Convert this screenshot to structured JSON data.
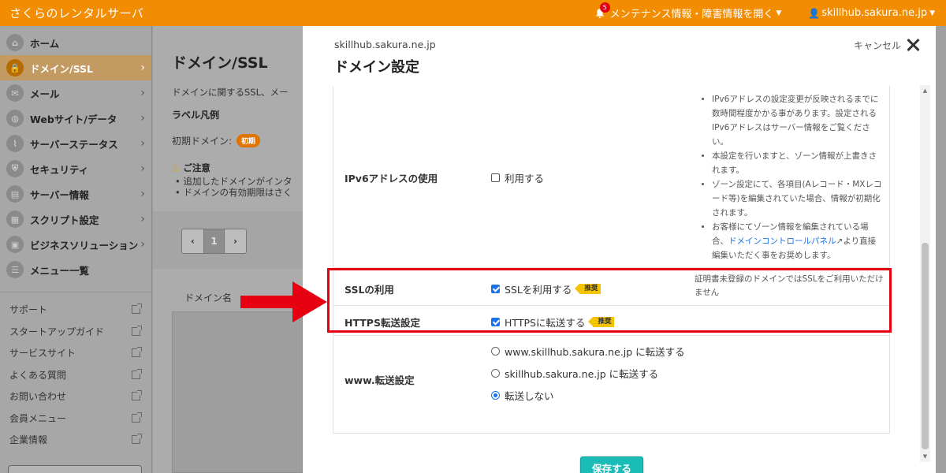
{
  "header": {
    "brand": "さくらのレンタルサーバ",
    "notification_count": "5",
    "maintenance_label": "メンテナンス情報・障害情報を開く",
    "user_label": "skillhub.sakura.ne.jp",
    "accent_color": "#f28c00"
  },
  "sidebar": {
    "items": [
      {
        "label": "ホーム",
        "icon": "home-icon"
      },
      {
        "label": "ドメイン/SSL",
        "icon": "lock-icon",
        "active": true
      },
      {
        "label": "メール",
        "icon": "mail-icon"
      },
      {
        "label": "Webサイト/データ",
        "icon": "globe-icon"
      },
      {
        "label": "サーバーステータス",
        "icon": "chart-icon"
      },
      {
        "label": "セキュリティ",
        "icon": "shield-icon"
      },
      {
        "label": "サーバー情報",
        "icon": "server-icon"
      },
      {
        "label": "スクリプト設定",
        "icon": "script-icon"
      },
      {
        "label": "ビジネスソリューション",
        "icon": "briefcase-icon"
      },
      {
        "label": "メニュー一覧",
        "icon": "list-icon"
      }
    ],
    "links": [
      "サポート",
      "スタートアップガイド",
      "サービスサイト",
      "よくある質問",
      "お問い合わせ",
      "会員メニュー",
      "企業情報"
    ]
  },
  "background_page": {
    "title": "ドメイン/SSL",
    "description": "ドメインに関するSSL、メー",
    "label_legend": "ラベル凡例",
    "initial_domain": "初期ドメイン:",
    "initial_tag": "初期",
    "caution": "ご注意",
    "bullet1": "追加したドメインがインタ",
    "bullet2": "ドメインの有効期限はさく",
    "page_current": "1",
    "column_domain": "ドメイン名"
  },
  "modal": {
    "subtitle": "skillhub.sakura.ne.jp",
    "title": "ドメイン設定",
    "cancel_label": "キャンセル",
    "save_label": "保存する",
    "save_color": "#1bbcb7",
    "ipv6": {
      "label": "IPv6アドレスの使用",
      "option": "利用する",
      "checked": false,
      "notes": [
        "IPv6アドレスの設定変更が反映されるまでに数時間程度かかる事があります。設定されるIPv6アドレスはサーバー情報をご覧ください。",
        "本設定を行いますと、ゾーン情報が上書きされます。",
        "ゾーン設定にて、各項目(Aレコード・MXレコード等)を編集されていた場合、情報が初期化されます。"
      ],
      "note4_before": "お客様にてゾーン情報を編集されている場合、",
      "note4_link": "ドメインコントロールパネル",
      "note4_after": "より直接編集いただく事をお奨めします。"
    },
    "ssl": {
      "label": "SSLの利用",
      "option": "SSLを利用する",
      "checked": true,
      "tag": "推奨",
      "note": "証明書未登録のドメインではSSLをご利用いただけません"
    },
    "https": {
      "label": "HTTPS転送設定",
      "option": "HTTPSに転送する",
      "checked": true,
      "tag": "推奨"
    },
    "www": {
      "label": "www.転送設定",
      "options": [
        "www.skillhub.sakura.ne.jp に転送する",
        "skillhub.sakura.ne.jp に転送する",
        "転送しない"
      ],
      "selected_index": 2
    }
  },
  "annotation": {
    "highlight_color": "#e60012"
  }
}
